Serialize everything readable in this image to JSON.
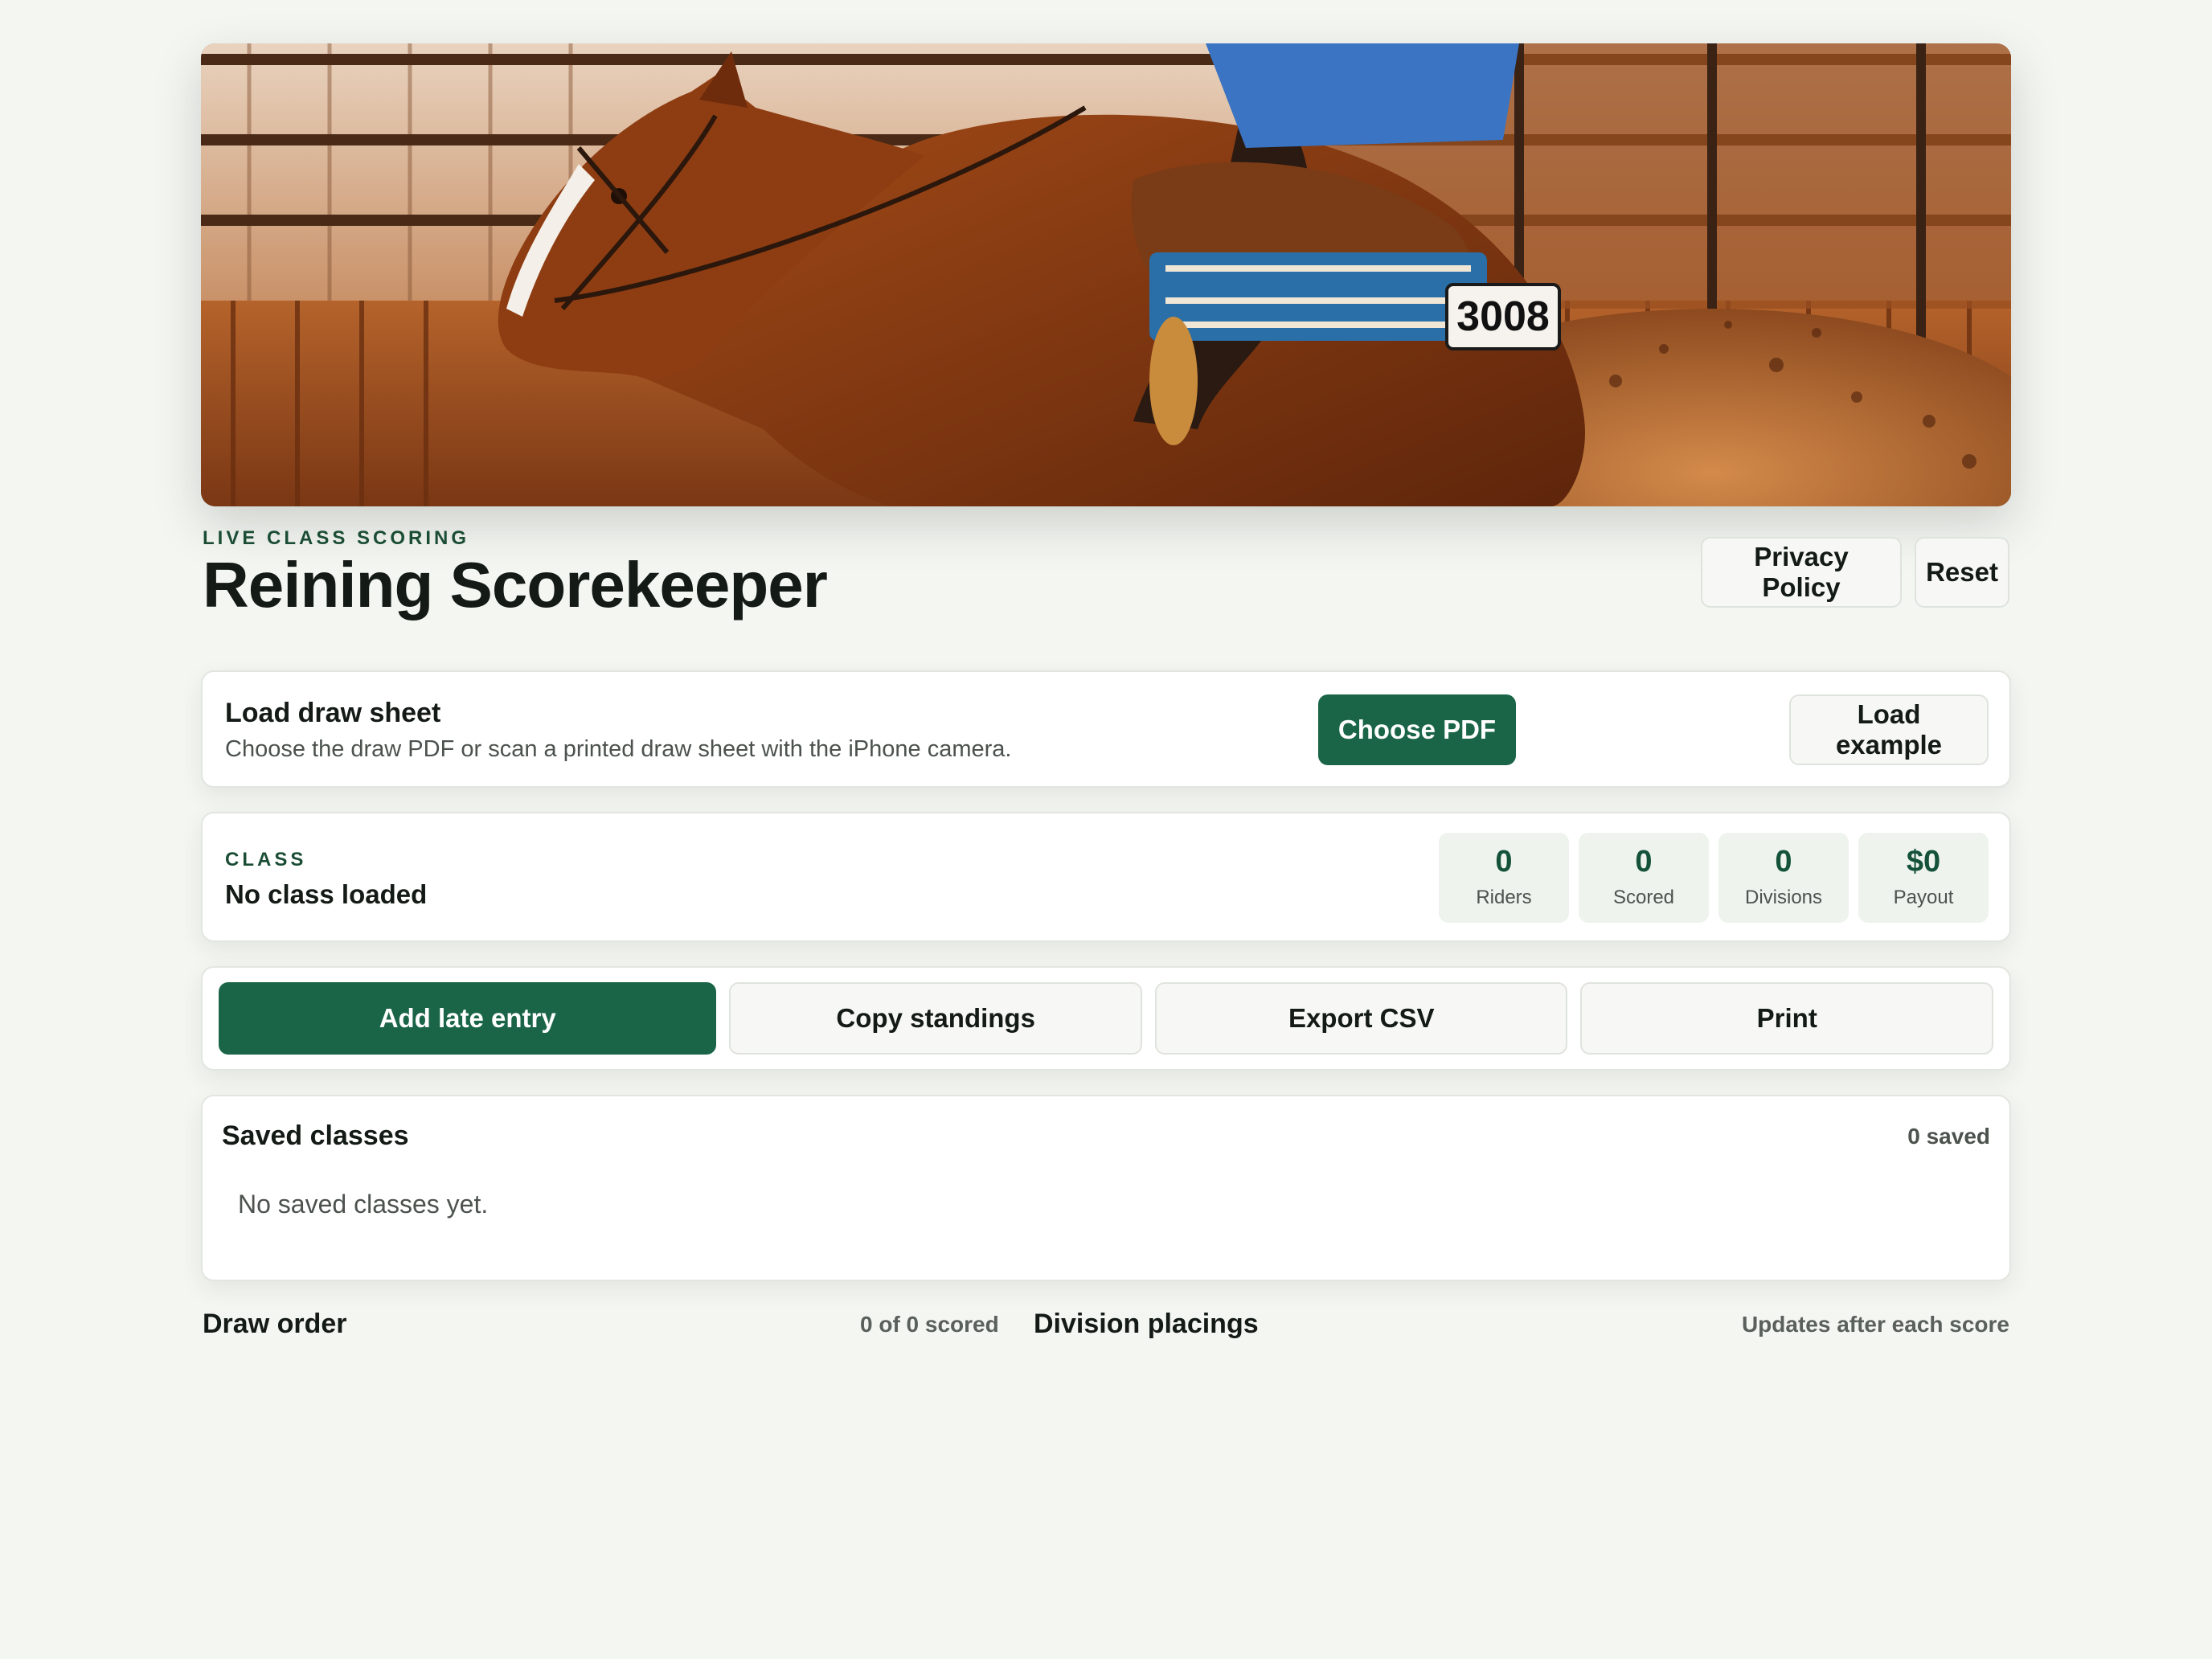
{
  "hero": {
    "image_alt": "Reining horse and rider sliding in indoor arena",
    "saddle_pad_number": "3008"
  },
  "header": {
    "eyebrow": "LIVE CLASS SCORING",
    "title": "Reining Scorekeeper",
    "privacy_label": "Privacy Policy",
    "reset_label": "Reset"
  },
  "load": {
    "title": "Load draw sheet",
    "description": "Choose the draw PDF or scan a printed draw sheet with the iPhone camera.",
    "choose_label": "Choose PDF",
    "example_label": "Load example"
  },
  "class_info": {
    "eyebrow": "CLASS",
    "name": "No class loaded",
    "stats": [
      {
        "value": "0",
        "label": "Riders"
      },
      {
        "value": "0",
        "label": "Scored"
      },
      {
        "value": "0",
        "label": "Divisions"
      },
      {
        "value": "$0",
        "label": "Payout"
      }
    ]
  },
  "actions": {
    "add_late_entry": "Add late entry",
    "copy_standings": "Copy standings",
    "export_csv": "Export CSV",
    "print": "Print"
  },
  "saved": {
    "title": "Saved classes",
    "count": "0 saved",
    "empty": "No saved classes yet."
  },
  "draw_order": {
    "title": "Draw order",
    "meta": "0 of 0 scored"
  },
  "placings": {
    "title": "Division placings",
    "meta": "Updates after each score"
  },
  "colors": {
    "accent": "#1a6548",
    "eyebrow": "#1b4d34",
    "background": "#f4f6f2"
  }
}
